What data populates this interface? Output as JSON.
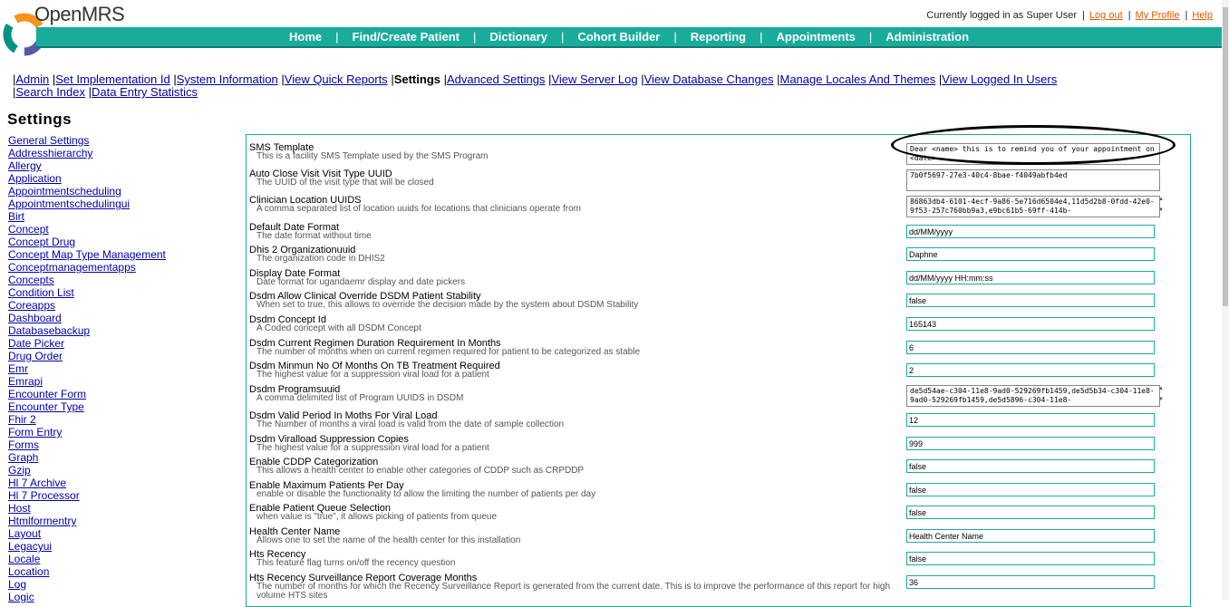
{
  "header": {
    "logo_text": "OpenMRS",
    "logged_in_text": "Currently logged in as Super User",
    "logout": "Log out",
    "my_profile": "My Profile",
    "help": "Help",
    "colors": {
      "nav_bg": "#1aac9b",
      "logo_orange": "#f7941d",
      "logo_purple": "#5b57a6",
      "logo_teal": "#009384"
    }
  },
  "nav": [
    "Home",
    "Find/Create Patient",
    "Dictionary",
    "Cohort Builder",
    "Reporting",
    "Appointments",
    "Administration"
  ],
  "admin_links": [
    "Admin",
    "Set Implementation Id",
    "System Information",
    "View Quick Reports",
    "Settings",
    "Advanced Settings",
    "View Server Log",
    "View Database Changes",
    "Manage Locales And Themes",
    "View Logged In Users",
    "Search Index",
    "Data Entry Statistics"
  ],
  "page_title": "Settings",
  "sidebar": [
    "General Settings",
    "Addresshierarchy",
    "Allergy",
    "Application",
    "Appointmentscheduling",
    "Appointmentschedulingui",
    "Birt",
    "Concept",
    "Concept Drug",
    "Concept Map Type Management",
    "Conceptmanagementapps",
    "Concepts",
    "Condition List",
    "Coreapps",
    "Dashboard",
    "Databasebackup",
    "Date Picker",
    "Drug Order",
    "Emr",
    "Emrapi",
    "Encounter Form",
    "Encounter Type",
    "Fhir 2",
    "Form Entry",
    "Forms",
    "Graph",
    "Gzip",
    "Hl 7 Archive",
    "Hl 7 Processor",
    "Host",
    "Htmlformentry",
    "Layout",
    "Legacyui",
    "Locale",
    "Location",
    "Log",
    "Logic"
  ],
  "settings": [
    {
      "name": "SMS Template",
      "desc": "This is a facility SMS Template used by the SMS Program",
      "value": "Dear <name> this is to remind you of your appointment on <date>",
      "type": "textarea"
    },
    {
      "name": "Auto Close Visit Visit Type UUID",
      "desc": "The UUID of the visit type that will be closed",
      "value": "7b0f5697-27e3-40c4-8bae-f4049abfb4ed",
      "type": "textarea"
    },
    {
      "name": "Clinician Location UUIDS",
      "desc": "A comma separated list of location uuids for locations that clinicians operate from",
      "value": "86863db4-6101-4ecf-9a86-5e716d6504e4,11d5d2b8-0fdd-42e0-9f53-257c760bb9a3,e9bc61b5-69ff-414b-",
      "type": "textarea"
    },
    {
      "name": "Default Date Format",
      "desc": "The date format without time",
      "value": "dd/MM/yyyy",
      "type": "input"
    },
    {
      "name": "Dhis 2 Organizationuuid",
      "desc": "The organization code in DHIS2",
      "value": "Daphne",
      "type": "input"
    },
    {
      "name": "Display Date Format",
      "desc": "Date format for ugandaemr display and date pickers",
      "value": "dd/MM/yyyy HH:mm:ss",
      "type": "input"
    },
    {
      "name": "Dsdm Allow Clinical Override DSDM Patient Stability",
      "desc": "When set to true, this allows to override the decision made by the system about DSDM Stability",
      "value": "false",
      "type": "input"
    },
    {
      "name": "Dsdm Concept Id",
      "desc": "A Coded concept with all DSDM Concept",
      "value": "165143",
      "type": "input"
    },
    {
      "name": "Dsdm Current Regimen Duration Requirement In Months",
      "desc": "The number of months when on current regimen required for patient to be categorized as stable",
      "value": "6",
      "type": "input"
    },
    {
      "name": "Dsdm Minmun No Of Months On TB Treatment Required",
      "desc": "The highest value for a suppression viral load for a patient",
      "value": "2",
      "type": "input"
    },
    {
      "name": "Dsdm Programsuuid",
      "desc": "A comma delimited list of Program UUIDS in DSDM",
      "value": "de5d54ae-c304-11e8-9ad0-529269fb1459,de5d5b34-c304-11e8-9ad0-529269fb1459,de5d5896-c304-11e8-",
      "type": "textarea"
    },
    {
      "name": "Dsdm Valid Period In Moths For Viral Load",
      "desc": "The Number of months a viral load is valid from the date of sample collection",
      "value": "12",
      "type": "input"
    },
    {
      "name": "Dsdm Viralload Suppression Copies",
      "desc": "The highest value for a suppression viral load for a patient",
      "value": "999",
      "type": "input"
    },
    {
      "name": "Enable CDDP Categorization",
      "desc": "This allows a health center to enable other categories of CDDP such as CRPDDP",
      "value": "false",
      "type": "input"
    },
    {
      "name": "Enable Maximum Patients Per Day",
      "desc": "enable or disable the functionality to allow the limiting the number of patients per day",
      "value": "false",
      "type": "input"
    },
    {
      "name": "Enable Patient Queue Selection",
      "desc": "when value is \"true\", it allows picking of patients from queue",
      "value": "false",
      "type": "input"
    },
    {
      "name": "Health Center Name",
      "desc": "Allows one to set the name of the health center for this installation",
      "value": "Health Center Name",
      "type": "input"
    },
    {
      "name": "Hts Recency",
      "desc": "This feature flag turns on/off the recency question",
      "value": "false",
      "type": "input"
    },
    {
      "name": "Hts Recency Surveillance Report Coverage Months",
      "desc": "The number of months for which the Recency Surveillance Report is generated from the current date. This is to improve the performance of this report for high volume HTS sites",
      "value": "36",
      "type": "input"
    }
  ]
}
